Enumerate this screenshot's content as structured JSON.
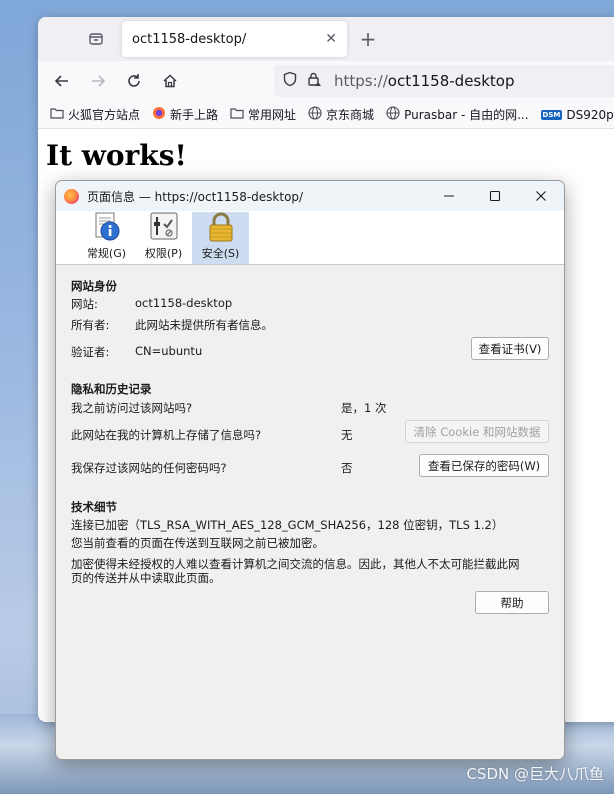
{
  "browser": {
    "tab_title": "oct1158-desktop/",
    "tab_close": "✕",
    "new_tab": "+",
    "url_scheme": "https://",
    "url_host": "oct1158-desktop",
    "bookmarks": [
      {
        "label": "火狐官方站点",
        "icon": "folder-icon"
      },
      {
        "label": "新手上路",
        "icon": "firefox-icon"
      },
      {
        "label": "常用网址",
        "icon": "folder-icon"
      },
      {
        "label": "京东商城",
        "icon": "globe-icon"
      },
      {
        "label": "Purasbar - 自由的网...",
        "icon": "globe-icon"
      },
      {
        "label": "DS920p",
        "icon": "dsm-icon"
      }
    ],
    "dsm_badge": "DSM"
  },
  "page": {
    "heading": "It works!"
  },
  "dialog": {
    "title": "页面信息 — https://oct1158-desktop/",
    "tabs": [
      {
        "label": "常规(G)",
        "icon": "info-icon"
      },
      {
        "label": "权限(P)",
        "icon": "permissions-icon"
      },
      {
        "label": "安全(S)",
        "icon": "lock-icon",
        "active": true
      }
    ],
    "identity": {
      "title": "网站身份",
      "website_label": "网站:",
      "website_value": "oct1158-desktop",
      "owner_label": "所有者:",
      "owner_value": "此网站未提供所有者信息。",
      "verifier_label": "验证者:",
      "verifier_value": "CN=ubuntu",
      "view_cert_button": "查看证书(V)"
    },
    "privacy": {
      "title": "隐私和历史记录",
      "q_visited": "我之前访问过该网站吗?",
      "a_visited": "是，1 次",
      "q_stored": "此网站在我的计算机上存储了信息吗?",
      "a_stored": "无",
      "clear_button": "清除 Cookie 和网站数据",
      "q_passwords": "我保存过该网站的任何密码吗?",
      "a_passwords": "否",
      "view_passwords_button": "查看已保存的密码(W)"
    },
    "technical": {
      "title": "技术细节",
      "line1": "连接已加密（TLS_RSA_WITH_AES_128_GCM_SHA256，128 位密钥，TLS 1.2）",
      "line2": "您当前查看的页面在传送到互联网之前已被加密。",
      "line3": "加密使得未经授权的人难以查看计算机之间交流的信息。因此，其他人不太可能拦截此网",
      "line4": "页的传送并从中读取此页面。"
    },
    "help_button": "帮助"
  },
  "watermark": "CSDN @巨大八爪鱼",
  "colors": {
    "active_tab_bg": "#cddcf0",
    "dialog_bg": "#f0f0f0",
    "desktop": "#97b6e0"
  }
}
